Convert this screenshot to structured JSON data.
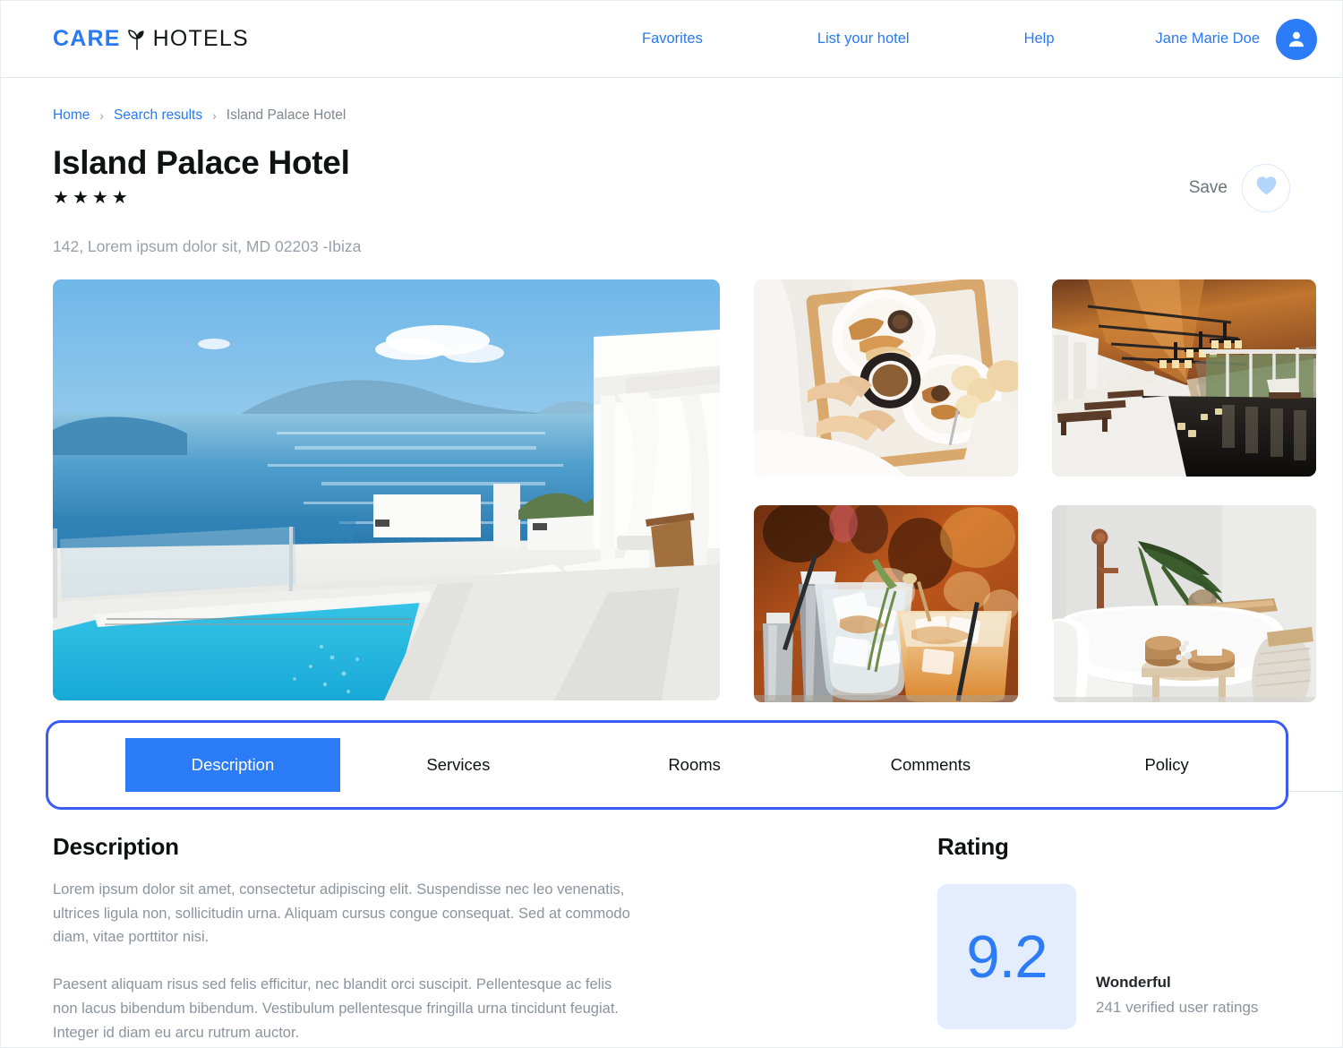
{
  "header": {
    "logo": {
      "brand": "CARE",
      "suffix": "HOTELS",
      "icon": "leaf-sprout-icon"
    },
    "nav": {
      "favorites": "Favorites",
      "list_your_hotel": "List your hotel",
      "help": "Help",
      "user_name": "Jane Marie Doe",
      "avatar_icon": "user-avatar-icon"
    }
  },
  "breadcrumb": {
    "home": "Home",
    "search_results": "Search results",
    "current": "Island Palace Hotel",
    "separator": "›"
  },
  "hotel": {
    "title": "Island Palace Hotel",
    "star_rating": 4,
    "star_glyph": "★",
    "address": "142, Lorem ipsum dolor sit, MD 02203 -Ibiza",
    "save_label": "Save",
    "save_icon": "heart-icon"
  },
  "gallery": {
    "hero_alt": "infinity pool with sea view",
    "thumbs": [
      "breakfast tray in bed",
      "indoor spa pool",
      "cocktails at the bar",
      "bathroom with freestanding tub"
    ]
  },
  "tabs": [
    {
      "label": "Description",
      "active": true
    },
    {
      "label": "Services",
      "active": false
    },
    {
      "label": "Rooms",
      "active": false
    },
    {
      "label": "Comments",
      "active": false
    },
    {
      "label": "Policy",
      "active": false
    }
  ],
  "description": {
    "heading": "Description",
    "paragraph_1": "Lorem ipsum dolor sit amet, consectetur adipiscing elit. Suspendisse nec leo venenatis, ultrices ligula non, sollicitudin urna. Aliquam cursus congue consequat. Sed at commodo diam, vitae porttitor nisi.",
    "paragraph_2": "Paesent aliquam risus sed felis efficitur, nec blandit orci suscipit. Pellentesque ac felis non lacus bibendum bibendum. Vestibulum pellentesque fringilla urna tincidunt feugiat. Integer id diam eu arcu rutrum auctor."
  },
  "rating": {
    "heading": "Rating",
    "score": "9.2",
    "word": "Wonderful",
    "count_text": "241  verified user ratings"
  },
  "colors": {
    "accent_blue": "#2b7cf6",
    "link_blue": "#2979f2",
    "focus_ring": "#3b5bf5",
    "score_bg": "#e3edfd",
    "heart_fill": "#b3d4fb",
    "muted_text": "#8b949e"
  }
}
